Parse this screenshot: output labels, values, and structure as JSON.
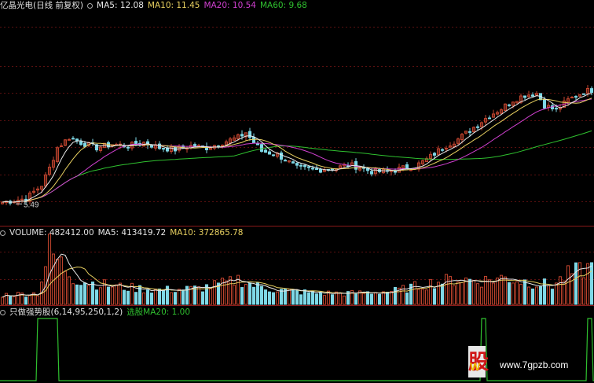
{
  "colors": {
    "up": "#c4452f",
    "down": "#7fd8e6",
    "ma5": "#e8e8e8",
    "ma10": "#e8d060",
    "ma20": "#d040d0",
    "ma60": "#2fc02f",
    "grid": "#5a1010",
    "sep": "#8a1a1a",
    "label": "#d0d0d0",
    "signal": "#2fc02f"
  },
  "price_panel": {
    "title": "亿晶光电(日线 前复权)",
    "ma5_label": "MA5: 12.08",
    "ma10_label": "MA10: 11.45",
    "ma20_label": "MA20: 10.54",
    "ma60_label": "MA60: 9.68",
    "low_marker": "5.49"
  },
  "volume_panel": {
    "vol_label": "VOLUME: 482412.00",
    "ma5_label": "MA5: 413419.72",
    "ma10_label": "MA10: 372865.78"
  },
  "indicator_panel": {
    "name_label": "只做强势股(6,14,95,250,1,2)",
    "signal_label": "选股MA20: 1.00"
  },
  "watermark": {
    "site": "www.7gpzb.com"
  },
  "chart_data": [
    {
      "type": "candlestick",
      "title": "亿晶光电(日线 前复权)",
      "series": [
        {
          "name": "MA5",
          "last": 12.08
        },
        {
          "name": "MA10",
          "last": 11.45
        },
        {
          "name": "MA20",
          "last": 10.54
        },
        {
          "name": "MA60",
          "last": 9.68
        }
      ],
      "low_marker": 5.49,
      "close_path": [
        [
          0,
          5.6
        ],
        [
          6,
          5.8
        ],
        [
          10,
          6.6
        ],
        [
          12,
          7.6
        ],
        [
          14,
          8.8
        ],
        [
          17,
          9.4
        ],
        [
          20,
          9.1
        ],
        [
          24,
          8.8
        ],
        [
          28,
          9.0
        ],
        [
          32,
          8.9
        ],
        [
          36,
          9.1
        ],
        [
          40,
          8.8
        ],
        [
          44,
          8.7
        ],
        [
          48,
          8.9
        ],
        [
          52,
          8.8
        ],
        [
          56,
          9.1
        ],
        [
          60,
          9.4
        ],
        [
          62,
          9.7
        ],
        [
          64,
          9.1
        ],
        [
          66,
          8.6
        ],
        [
          70,
          8.4
        ],
        [
          72,
          8.1
        ],
        [
          75,
          7.6
        ],
        [
          80,
          7.5
        ],
        [
          85,
          7.6
        ],
        [
          88,
          7.8
        ],
        [
          90,
          7.7
        ],
        [
          94,
          7.4
        ],
        [
          98,
          7.4
        ],
        [
          102,
          7.6
        ],
        [
          105,
          7.7
        ],
        [
          108,
          8.1
        ],
        [
          112,
          8.8
        ],
        [
          116,
          9.3
        ],
        [
          120,
          10.0
        ],
        [
          124,
          10.7
        ],
        [
          127,
          11.1
        ],
        [
          130,
          11.6
        ],
        [
          133,
          11.9
        ],
        [
          136,
          12.0
        ],
        [
          138,
          11.3
        ],
        [
          141,
          11.0
        ],
        [
          144,
          11.6
        ],
        [
          148,
          12.1
        ],
        [
          150,
          12.2
        ]
      ]
    },
    {
      "type": "bar",
      "title": "VOLUME",
      "series": [
        {
          "name": "VOLUME",
          "last": 482412.0
        },
        {
          "name": "MA5",
          "last": 413419.72
        },
        {
          "name": "MA10",
          "last": 372865.78
        }
      ],
      "volume_path": [
        [
          0,
          12
        ],
        [
          9,
          14
        ],
        [
          11,
          50
        ],
        [
          12,
          72
        ],
        [
          13,
          62
        ],
        [
          15,
          52
        ],
        [
          18,
          34
        ],
        [
          20,
          30
        ],
        [
          24,
          26
        ],
        [
          30,
          22
        ],
        [
          40,
          18
        ],
        [
          50,
          20
        ],
        [
          58,
          28
        ],
        [
          60,
          32
        ],
        [
          64,
          24
        ],
        [
          70,
          18
        ],
        [
          80,
          14
        ],
        [
          90,
          14
        ],
        [
          100,
          17
        ],
        [
          110,
          28
        ],
        [
          116,
          32
        ],
        [
          122,
          30
        ],
        [
          128,
          34
        ],
        [
          134,
          28
        ],
        [
          140,
          24
        ],
        [
          144,
          38
        ],
        [
          148,
          44
        ],
        [
          150,
          48
        ]
      ]
    },
    {
      "type": "line",
      "title": "只做强势股(6,14,95,250,1,2)",
      "series": [
        {
          "name": "选股MA20",
          "last": 1.0
        }
      ],
      "signal_intervals": [
        [
          9,
          14
        ],
        [
          122,
          123
        ],
        [
          149,
          150
        ]
      ]
    }
  ]
}
